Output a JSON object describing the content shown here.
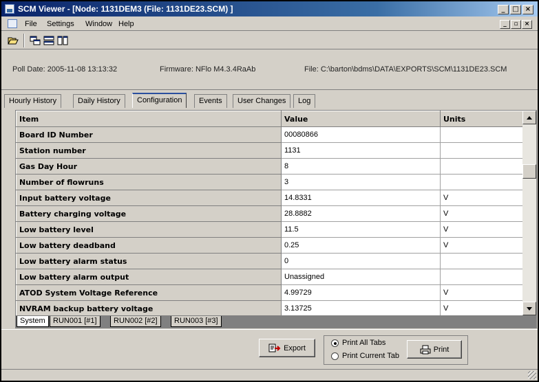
{
  "window": {
    "title": "SCM Viewer - [Node: 1131DEM3 (File: 1131DE23.SCM) ]",
    "controls": [
      "_",
      "□",
      "×"
    ],
    "mdi_controls": [
      "_",
      "▫",
      "×"
    ]
  },
  "menu": [
    {
      "label": "File",
      "underline": "F"
    },
    {
      "label": "Settings",
      "underline": "S"
    },
    {
      "label": "Window",
      "underline": "W"
    },
    {
      "label": "Help",
      "underline": "H"
    }
  ],
  "toolbar": {
    "icons": [
      "open-folder-icon",
      "cascade-windows-icon",
      "tile-horizontal-icon",
      "tile-vertical-icon"
    ]
  },
  "info": {
    "poll_date": "Poll Date: 2005-11-08 13:13:32",
    "firmware": "Firmware: NFlo M4.3.4RaAb",
    "file": "File: C:\\barton\\bdms\\DATA\\EXPORTS\\SCM\\1131DE23.SCM"
  },
  "tabs": [
    {
      "label": "Hourly History",
      "active": false
    },
    {
      "label": "Daily History",
      "active": false
    },
    {
      "label": "Configuration",
      "active": true
    },
    {
      "label": "Events",
      "active": false
    },
    {
      "label": "User Changes",
      "active": false
    },
    {
      "label": "Log",
      "active": false
    }
  ],
  "grid": {
    "columns": [
      "Item",
      "Value",
      "Units"
    ],
    "rows": [
      {
        "item": "Board ID Number",
        "value": "00080866",
        "units": ""
      },
      {
        "item": "Station number",
        "value": "1131",
        "units": ""
      },
      {
        "item": "Gas Day Hour",
        "value": "8",
        "units": ""
      },
      {
        "item": "Number of flowruns",
        "value": "3",
        "units": ""
      },
      {
        "item": "Input battery voltage",
        "value": "14.8331",
        "units": "V"
      },
      {
        "item": "Battery charging voltage",
        "value": "28.8882",
        "units": "V"
      },
      {
        "item": "Low battery level",
        "value": "11.5",
        "units": "V"
      },
      {
        "item": "Low battery deadband",
        "value": "0.25",
        "units": "V"
      },
      {
        "item": "Low battery alarm status",
        "value": "0",
        "units": ""
      },
      {
        "item": "Low battery alarm output",
        "value": "Unassigned",
        "units": ""
      },
      {
        "item": "ATOD System Voltage Reference",
        "value": "4.99729",
        "units": "V"
      },
      {
        "item": "NVRAM backup battery voltage",
        "value": "3.13725",
        "units": "V"
      }
    ]
  },
  "sheets": [
    {
      "label": "System",
      "active": true
    },
    {
      "label": "RUN001 [#1]",
      "active": false
    },
    {
      "label": "RUN002 [#2]",
      "active": false
    },
    {
      "label": "RUN003 [#3]",
      "active": false
    }
  ],
  "actions": {
    "export_label": "Export",
    "print_label": "Print",
    "print_all_tabs": "Print All Tabs",
    "print_current_tab": "Print Current Tab",
    "print_scope_selected": "Print All Tabs"
  },
  "colors": {
    "titlebar": "#0a246a",
    "face": "#d4d0c8",
    "active_tab_accent": "#2a4f9e"
  }
}
